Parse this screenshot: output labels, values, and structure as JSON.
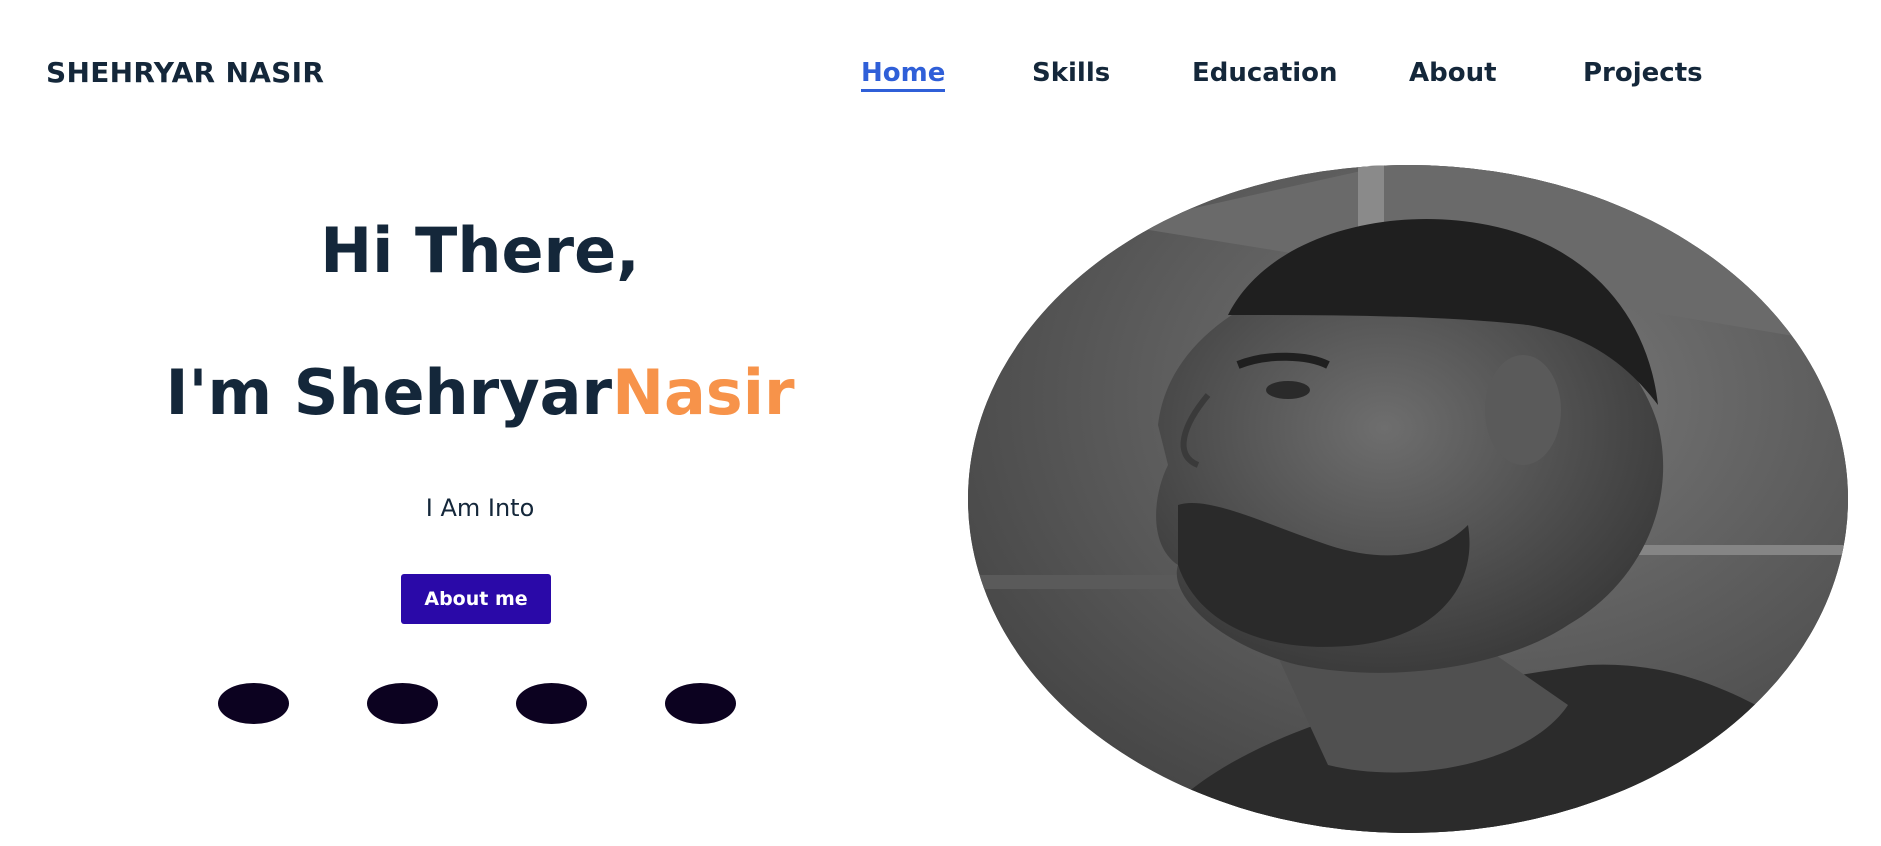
{
  "header": {
    "brand": "SHEHRYAR NASIR",
    "nav": [
      {
        "label": "Home",
        "active": true
      },
      {
        "label": "Skills",
        "active": false
      },
      {
        "label": "Education",
        "active": false
      },
      {
        "label": "About",
        "active": false
      },
      {
        "label": "Projects",
        "active": false
      }
    ]
  },
  "hero": {
    "greeting": "Hi There,",
    "intro_prefix": "I'm ",
    "first_name": "Shehryar",
    "last_name": "Nasir",
    "subtitle": "I Am Into",
    "button_label": "About me"
  },
  "social_links": [
    {
      "icon": "social-icon-1"
    },
    {
      "icon": "social-icon-2"
    },
    {
      "icon": "social-icon-3"
    },
    {
      "icon": "social-icon-4"
    }
  ],
  "portrait": {
    "description_icon": "profile-photo"
  },
  "colors": {
    "text_dark": "#14273a",
    "accent_orange": "#f7934a",
    "nav_active": "#2f5fd8",
    "button_bg": "#2a09a8",
    "social_bg": "#0c0220"
  }
}
